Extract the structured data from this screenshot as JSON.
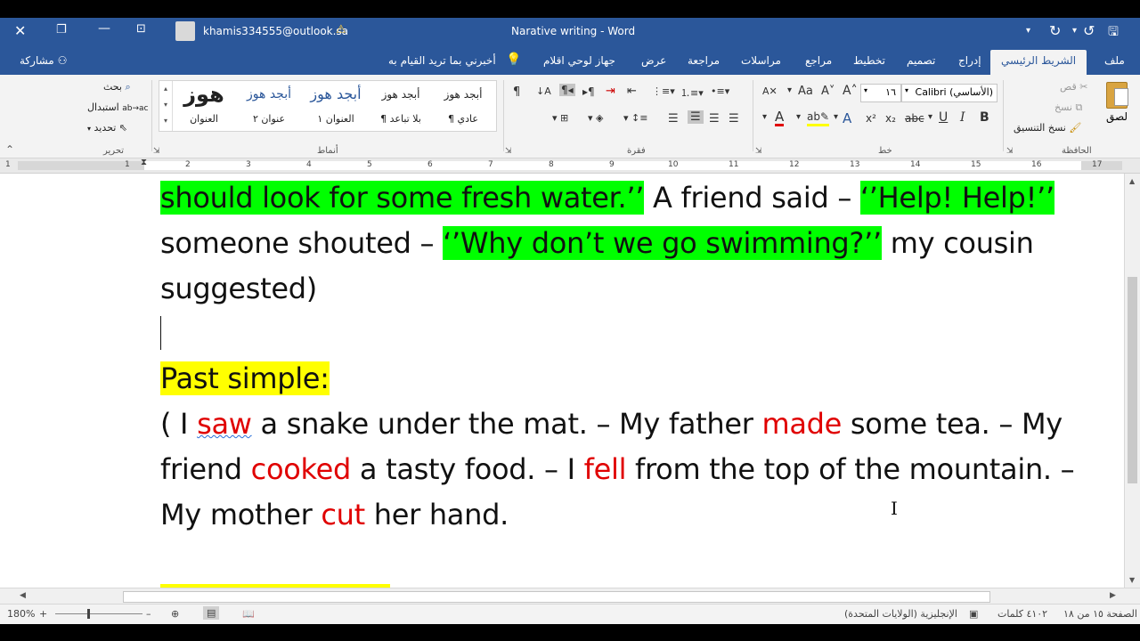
{
  "window": {
    "doc_title": "Narative writing  -  Word",
    "account": "khamis334555@outlook.sa"
  },
  "tabs": [
    "ملف",
    "الشريط الرئيسي",
    "إدراج",
    "تصميم",
    "تخطيط",
    "مراجع",
    "مراسلات",
    "مراجعة",
    "عرض",
    "جهاز لوحي اقلام"
  ],
  "tell_me": "أخبرني بما تريد القيام به",
  "share": "مشاركة",
  "ribbon": {
    "clipboard": {
      "paste": "لصق",
      "cut": "قص",
      "copy": "نسخ",
      "format_painter": "نسخ التنسيق",
      "group": "الحافظة"
    },
    "font": {
      "name": "Calibri (الأساسي)",
      "size": "١٦",
      "group": "خط"
    },
    "paragraph": {
      "group": "فقرة"
    },
    "styles": {
      "items": [
        {
          "sample": "أبجد هوز",
          "label": "¶ عادي"
        },
        {
          "sample": "أبجد هوز",
          "label": "¶ بلا تباعد"
        },
        {
          "sample": "أبجد هوز",
          "label": "العنوان ١"
        },
        {
          "sample": "أبجد هوز",
          "label": "عنوان ٢"
        },
        {
          "sample": "هوز",
          "label": "العنوان"
        }
      ],
      "group": "أنماط"
    },
    "editing": {
      "find": "بحث",
      "replace": "استبدال",
      "select": "تحديد",
      "group": "تحرير"
    }
  },
  "ruler_numbers": [
    "17",
    "16",
    "15",
    "14",
    "13",
    "12",
    "11",
    "10",
    "9",
    "8",
    "7",
    "6",
    "5",
    "4",
    "3",
    "2",
    "1",
    "1"
  ],
  "document": {
    "line1": {
      "seg1": "should look for some fresh water.’’",
      "seg2": " A friend said – ",
      "seg3": "‘’Help! Help!’’"
    },
    "line2": {
      "seg1": "someone shouted – ",
      "seg2": "‘’Why don’t we go swimming?’’",
      "seg3": " my cousin"
    },
    "line3": "suggested)",
    "heading": "Past simple:",
    "p1": {
      "a": "( I ",
      "b": "saw",
      "c": " a snake under the mat. – My father ",
      "d": "made",
      "e": " some tea. – My"
    },
    "p2": {
      "a": "friend ",
      "b": "cooked",
      "c": " a tasty food. – I ",
      "d": "fell",
      "e": " from the top of the mountain. –"
    },
    "p3": {
      "a": "My mother ",
      "b": "cut",
      "c": " her hand."
    }
  },
  "status": {
    "page": "الصفحة ١٥ من ١٨",
    "words": "٤١٠٢ كلمات",
    "language": "الإنجليزية (الولايات المتحدة)",
    "zoom": "180%"
  },
  "colors": {
    "word_blue": "#2b579a",
    "highlight_green": "#00ff00",
    "highlight_yellow": "#ffff00",
    "red_text": "#e00000"
  }
}
